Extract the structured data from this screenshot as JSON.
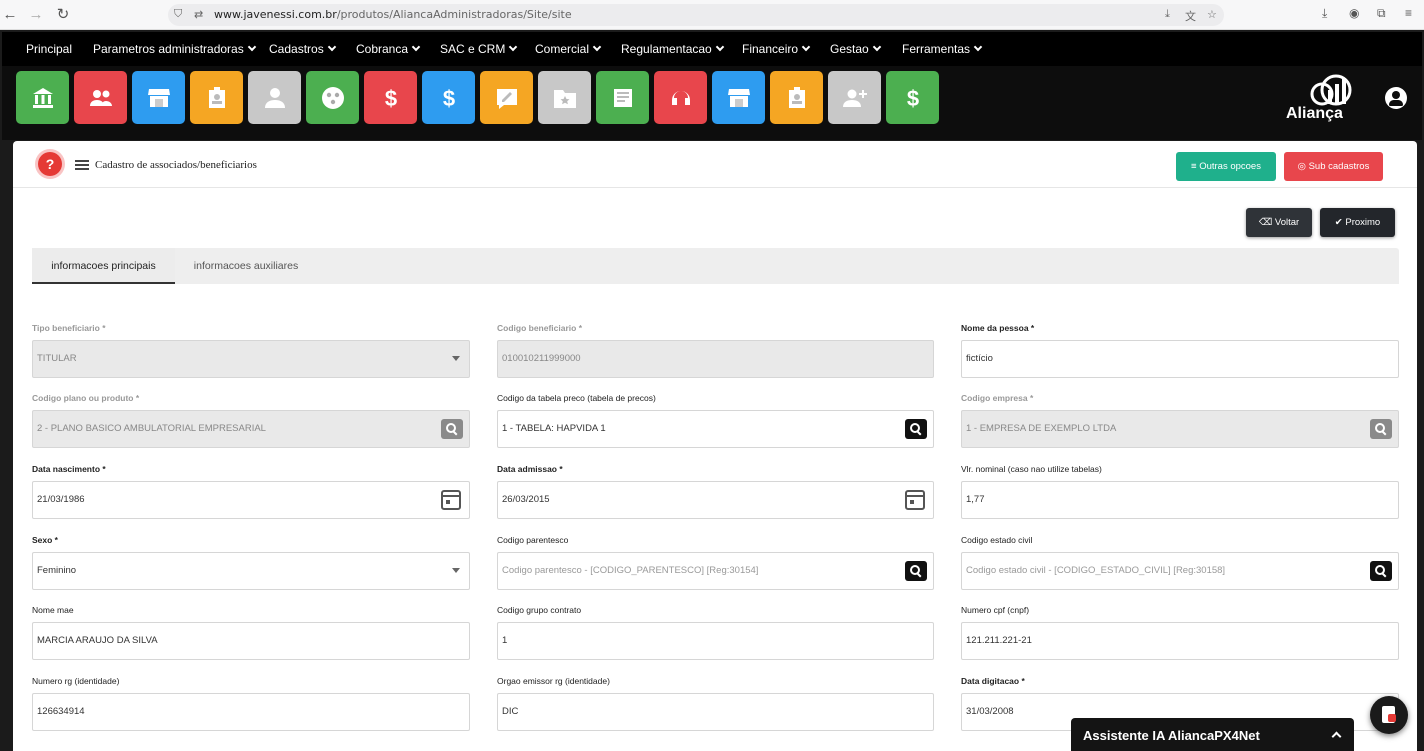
{
  "browser": {
    "url_domain": "www.javenessi.com.br",
    "url_path": "/produtos/AliancaAdministradoras/Site/site"
  },
  "menu": [
    {
      "label": "Principal",
      "has_dropdown": false
    },
    {
      "label": "Parametros administradoras",
      "has_dropdown": true
    },
    {
      "label": "Cadastros",
      "has_dropdown": true
    },
    {
      "label": "Cobranca",
      "has_dropdown": true
    },
    {
      "label": "SAC e CRM",
      "has_dropdown": true
    },
    {
      "label": "Comercial",
      "has_dropdown": true
    },
    {
      "label": "Regulamentacao",
      "has_dropdown": true
    },
    {
      "label": "Financeiro",
      "has_dropdown": true
    },
    {
      "label": "Gestao",
      "has_dropdown": true
    },
    {
      "label": "Ferramentas",
      "has_dropdown": true
    }
  ],
  "tiles": [
    {
      "icon": "bank-icon",
      "color": "#4caf50"
    },
    {
      "icon": "group-icon",
      "color": "#e8464c"
    },
    {
      "icon": "store-icon",
      "color": "#2e9cf0"
    },
    {
      "icon": "id-badge-icon",
      "color": "#f5a623"
    },
    {
      "icon": "person-icon",
      "color": "#c8c8c8"
    },
    {
      "icon": "circle-dots-icon",
      "color": "#4caf50"
    },
    {
      "icon": "dollar-icon",
      "color": "#e8464c"
    },
    {
      "icon": "dollar-icon",
      "color": "#2e9cf0"
    },
    {
      "icon": "edit-note-icon",
      "color": "#f5a623"
    },
    {
      "icon": "folder-star-icon",
      "color": "#c8c8c8"
    },
    {
      "icon": "newspaper-icon",
      "color": "#4caf50"
    },
    {
      "icon": "headset-icon",
      "color": "#e8464c"
    },
    {
      "icon": "store-icon",
      "color": "#2e9cf0"
    },
    {
      "icon": "id-badge-icon",
      "color": "#f5a623"
    },
    {
      "icon": "add-user-icon",
      "color": "#c8c8c8"
    },
    {
      "icon": "dollar-icon",
      "color": "#4caf50"
    }
  ],
  "header": {
    "title": "Cadastro de associados/beneficiarios",
    "outras_opcoes": "Outras opcoes",
    "sub_cadastros": "Sub cadastros",
    "voltar": "Voltar",
    "proximo": "Proximo"
  },
  "tabs": {
    "main": "informacoes principais",
    "aux": "informacoes auxiliares"
  },
  "form": {
    "tipo_beneficiario": {
      "label": "Tipo beneficiario *",
      "value": "TITULAR"
    },
    "codigo_beneficiario": {
      "label": "Codigo beneficiario *",
      "value": "010010211999000"
    },
    "nome_pessoa": {
      "label": "Nome da pessoa *",
      "value": "fictício"
    },
    "codigo_plano": {
      "label": "Codigo plano ou produto *",
      "value": "2  -  PLANO BASICO AMBULATORIAL EMPRESARIAL"
    },
    "codigo_tabela": {
      "label": "Codigo da tabela preco (tabela de precos)",
      "value": "1  -  TABELA: HAPVIDA 1"
    },
    "codigo_empresa": {
      "label": "Codigo empresa *",
      "value": "1  -  EMPRESA DE EXEMPLO LTDA"
    },
    "data_nascimento": {
      "label": "Data nascimento *",
      "value": "21/03/1986"
    },
    "data_admissao": {
      "label": "Data admissao *",
      "value": "26/03/2015"
    },
    "vlr_nominal": {
      "label": "Vlr. nominal (caso nao utilize tabelas)",
      "value": "1,77"
    },
    "sexo": {
      "label": "Sexo *",
      "value": "Feminino"
    },
    "codigo_parentesco": {
      "label": "Codigo parentesco",
      "placeholder": "Codigo parentesco - [CODIGO_PARENTESCO] [Reg:30154]"
    },
    "codigo_estado_civil": {
      "label": "Codigo estado civil",
      "placeholder": "Codigo estado civil - [CODIGO_ESTADO_CIVIL] [Reg:30158]"
    },
    "nome_mae": {
      "label": "Nome mae",
      "value": "MARCIA ARAUJO DA SILVA"
    },
    "codigo_grupo_contrato": {
      "label": "Codigo grupo contrato",
      "value": "1"
    },
    "numero_cpf": {
      "label": "Numero cpf (cnpf)",
      "value": "121.211.221-21"
    },
    "numero_rg": {
      "label": "Numero rg (identidade)",
      "value": "126634914"
    },
    "orgao_emissor": {
      "label": "Orgao emissor rg (identidade)",
      "value": "DIC"
    },
    "data_digitacao": {
      "label": "Data digitacao *",
      "value": "31/03/2008"
    }
  },
  "assistant": {
    "title": "Assistente IA AliancaPX4Net"
  },
  "logo": {
    "name": "Aliança"
  },
  "colors": {
    "green": "#1fb08c",
    "red": "#e8464c",
    "dark": "#2f3338"
  }
}
